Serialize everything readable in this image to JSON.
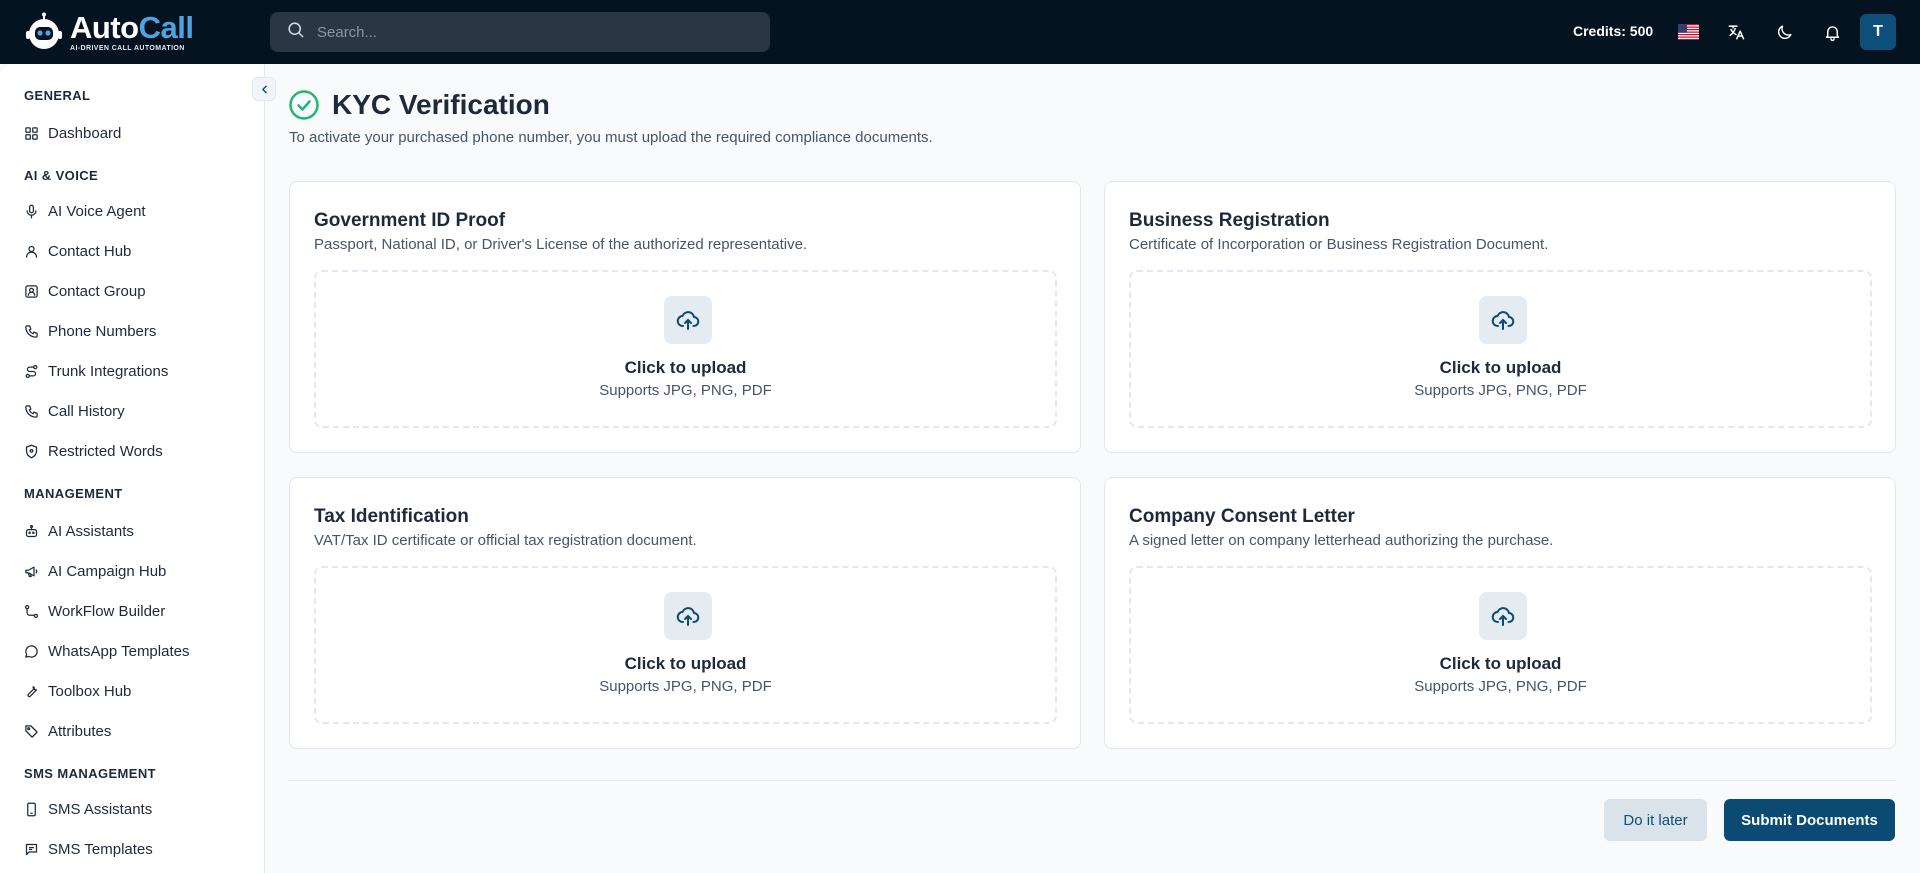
{
  "brand": {
    "name_part1": "Auto",
    "name_part2": "Call",
    "tagline": "AI-DRIVEN CALL AUTOMATION"
  },
  "search": {
    "placeholder": "Search..."
  },
  "header": {
    "credits": "Credits: 500",
    "avatar_initial": "T"
  },
  "sidebar": {
    "sections": [
      {
        "title": "GENERAL",
        "items": [
          {
            "label": "Dashboard",
            "icon": "grid-icon"
          }
        ]
      },
      {
        "title": "AI & VOICE",
        "items": [
          {
            "label": "AI Voice Agent",
            "icon": "microphone-icon"
          },
          {
            "label": "Contact Hub",
            "icon": "user-icon"
          },
          {
            "label": "Contact Group",
            "icon": "contact-card-icon"
          },
          {
            "label": "Phone Numbers",
            "icon": "phone-icon"
          },
          {
            "label": "Trunk Integrations",
            "icon": "route-icon"
          },
          {
            "label": "Call History",
            "icon": "phone-icon"
          },
          {
            "label": "Restricted Words",
            "icon": "shield-icon"
          }
        ]
      },
      {
        "title": "MANAGEMENT",
        "items": [
          {
            "label": "AI Assistants",
            "icon": "bot-icon"
          },
          {
            "label": "AI Campaign Hub",
            "icon": "megaphone-icon"
          },
          {
            "label": "WorkFlow Builder",
            "icon": "workflow-icon"
          },
          {
            "label": "WhatsApp Templates",
            "icon": "chat-bubble-icon"
          },
          {
            "label": "Toolbox Hub",
            "icon": "wrench-icon"
          },
          {
            "label": "Attributes",
            "icon": "tag-icon"
          }
        ]
      },
      {
        "title": "SMS MANAGEMENT",
        "items": [
          {
            "label": "SMS Assistants",
            "icon": "mobile-icon"
          },
          {
            "label": "SMS Templates",
            "icon": "message-square-icon"
          }
        ]
      }
    ]
  },
  "page": {
    "title": "KYC Verification",
    "subtitle": "To activate your purchased phone number, you must upload the required compliance documents."
  },
  "documents": [
    {
      "title": "Government ID Proof",
      "description": "Passport, National ID, or Driver's License of the authorized representative.",
      "upload_label": "Click to upload",
      "upload_hint": "Supports JPG, PNG, PDF"
    },
    {
      "title": "Business Registration",
      "description": "Certificate of Incorporation or Business Registration Document.",
      "upload_label": "Click to upload",
      "upload_hint": "Supports JPG, PNG, PDF"
    },
    {
      "title": "Tax Identification",
      "description": "VAT/Tax ID certificate or official tax registration document.",
      "upload_label": "Click to upload",
      "upload_hint": "Supports JPG, PNG, PDF"
    },
    {
      "title": "Company Consent Letter",
      "description": "A signed letter on company letterhead authorizing the purchase.",
      "upload_label": "Click to upload",
      "upload_hint": "Supports JPG, PNG, PDF"
    }
  ],
  "actions": {
    "later_label": "Do it later",
    "submit_label": "Submit Documents"
  },
  "colors": {
    "topbar": "#04131f",
    "primary": "#0b4a72",
    "success": "#22b573",
    "brand_accent": "#4fa3e0"
  }
}
